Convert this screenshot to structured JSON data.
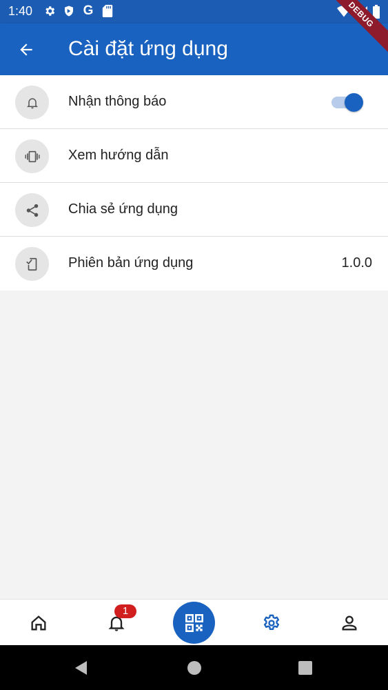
{
  "status_bar": {
    "time": "1:40",
    "icons_left": [
      "gear-icon",
      "shield-icon",
      "google-icon",
      "sd-card-icon"
    ],
    "icons_right": [
      "wifi-icon",
      "signal-icon",
      "battery-icon"
    ],
    "google_letter": "G"
  },
  "debug_banner": "DEBUG",
  "app_bar": {
    "title": "Cài đặt ứng dụng",
    "back_icon": "arrow-back-icon"
  },
  "settings": [
    {
      "icon": "bell-icon",
      "label": "Nhận thông báo",
      "type": "toggle",
      "on": true
    },
    {
      "icon": "vibration-icon",
      "label": "Xem hướng dẫn",
      "type": "link"
    },
    {
      "icon": "share-icon",
      "label": "Chia sẻ ứng dụng",
      "type": "link"
    },
    {
      "icon": "phone-check-icon",
      "label": "Phiên bản ứng dụng",
      "type": "value",
      "value": "1.0.0"
    }
  ],
  "bottom_nav": {
    "items": [
      "home-icon",
      "notification-icon",
      "qr-code-icon",
      "settings-icon",
      "profile-icon"
    ],
    "active": "settings-icon",
    "notification_badge": "1"
  },
  "colors": {
    "primary": "#1a62c0",
    "status_bar": "#1c5cb3",
    "badge": "#d11f1f",
    "background": "#f4f3f3"
  }
}
